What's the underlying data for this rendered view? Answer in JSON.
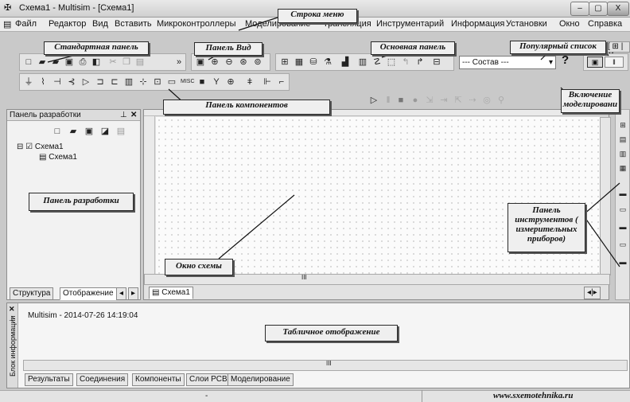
{
  "window": {
    "title": "Схема1 - Multisim - [Схема1]",
    "minimize": "–",
    "maximize": "▢",
    "close": "X"
  },
  "menu": [
    "Файл",
    "Редактор",
    "Вид",
    "Вставить",
    "Микроконтроллеры",
    "Моделирование",
    "Трансляция",
    "Инструментарий",
    "Информация",
    "Установки",
    "Окно",
    "Справка"
  ],
  "menu_right": "[ ⊞ | ✕",
  "toolbar": {
    "dropdown_value": "--- Состав ---",
    "help": "?"
  },
  "callouts": {
    "menu_bar": "Строка меню",
    "standard_panel": "Стандартная панель",
    "view_panel": "Панель Вид",
    "main_panel": "Основная панель",
    "popular_list": "Популярный список",
    "components_panel": "Панель компонентов",
    "simulation_toggle": "Включение моделировани",
    "design_panel": "Панель разработки",
    "schematic_window": "Окно схемы",
    "instruments_panel": "Панель инструментов ( измерительных приборов)",
    "spreadsheet_view": "Табличное отображение"
  },
  "design_toolbox": {
    "title": "Панель разработки",
    "tree_root": "Схема1",
    "tree_child": "Схема1",
    "tabs": [
      "Структура",
      "Отображение"
    ]
  },
  "schematic": {
    "tab": "Схема1",
    "scroll_mark": "III"
  },
  "log": {
    "side_title": "Блок информации",
    "text": "Multisim  -  2014-07-26 14:19:04",
    "scroll_mark": "III",
    "tabs": [
      "Результаты",
      "Соединения",
      "Компоненты",
      "Слои PCB",
      "Моделирование"
    ]
  },
  "status": {
    "center": "-",
    "watermark": "www.sxemotehnika.ru"
  }
}
